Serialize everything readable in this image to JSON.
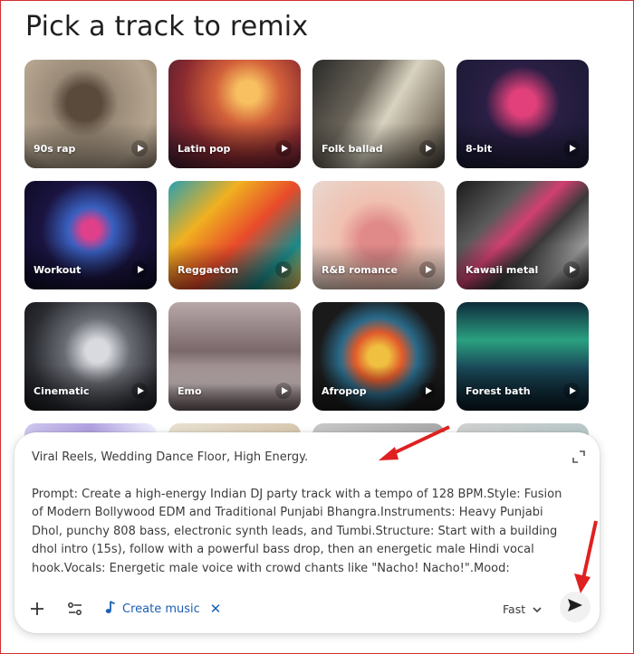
{
  "page": {
    "heading": "Pick a track to remix"
  },
  "tracks": [
    {
      "label": "90s rap"
    },
    {
      "label": "Latin pop"
    },
    {
      "label": "Folk ballad"
    },
    {
      "label": "8-bit"
    },
    {
      "label": "Workout"
    },
    {
      "label": "Reggaeton"
    },
    {
      "label": "R&B romance"
    },
    {
      "label": "Kawaii metal"
    },
    {
      "label": "Cinematic"
    },
    {
      "label": "Emo"
    },
    {
      "label": "Afropop"
    },
    {
      "label": "Forest bath"
    }
  ],
  "composer": {
    "line1": "Viral Reels, Wedding Dance Floor, High Energy.",
    "prompt": "Prompt: Create a high-energy Indian DJ party track with a tempo of 128 BPM.Style: Fusion of Modern Bollywood EDM and Traditional Punjabi Bhangra.Instruments: Heavy Punjabi Dhol, punchy 808 bass, electronic synth leads, and Tumbi.Structure: Start with a building dhol intro (15s), follow with a powerful bass drop, then an energetic male Hindi vocal hook.Vocals: Energetic male voice with crowd chants like \"Nacho! Nacho!\".Mood: Celebratory, club anthem,",
    "chip_label": "Create music",
    "speed_label": "Fast"
  },
  "icons": {
    "expand": "expand-icon",
    "add": "plus-icon",
    "tools": "sliders-icon",
    "music": "music-note-icon",
    "remove": "close-icon",
    "dropdown": "chevron-down-icon",
    "send": "send-icon",
    "play": "play-icon"
  },
  "colors": {
    "accent": "#1a5fb4",
    "annotation_arrow": "#e02020",
    "frame_border": "#d32f2f"
  }
}
